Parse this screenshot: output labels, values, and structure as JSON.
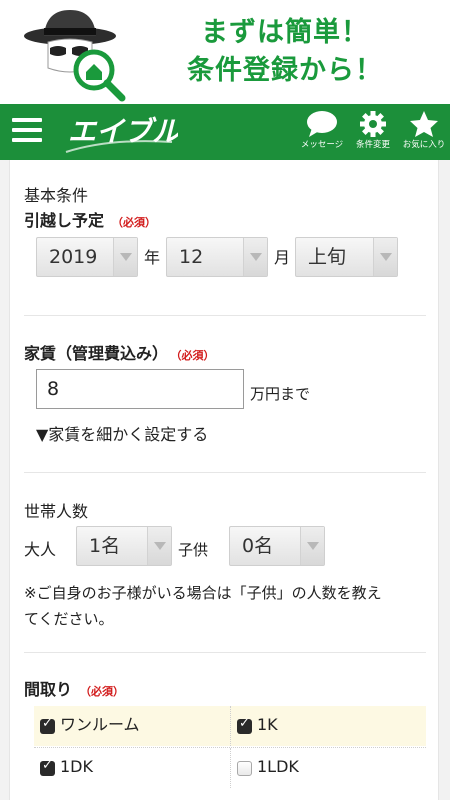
{
  "banner": {
    "line1": "まずは簡単！",
    "line2": "条件登録から！",
    "mascot_icon": "detective-search-icon",
    "text_color": "#1a9a3c"
  },
  "header": {
    "bg_color": "#1c8f3a",
    "logo_text": "エイブル",
    "menu_icon": "hamburger-menu-icon",
    "buttons": [
      {
        "icon": "speech-bubble-icon",
        "label": "メッセージ"
      },
      {
        "icon": "gear-icon",
        "label": "条件変更"
      },
      {
        "icon": "star-icon",
        "label": "お気に入り"
      }
    ]
  },
  "basic": {
    "section_label": "基本条件",
    "move_label": "引越し予定",
    "required": "（必須）",
    "year_value": "2019",
    "year_unit": "年",
    "month_value": "12",
    "month_unit": "月",
    "period_value": "上旬"
  },
  "rent": {
    "label": "家賃（管理費込み）",
    "required": "（必須）",
    "value": "8",
    "unit": "万円まで",
    "detail_link": "▼家賃を細かく設定する"
  },
  "household": {
    "label": "世帯人数",
    "adult_label": "大人",
    "adult_value": "1名",
    "child_label": "子供",
    "child_value": "0名",
    "note_line1": "※ご自身のお子様がいる場合は「子供」の人数を教え",
    "note_line2": "てください。"
  },
  "layout": {
    "label": "間取り",
    "required": "（必須）",
    "options": [
      {
        "label": "ワンルーム",
        "checked": true
      },
      {
        "label": "1K",
        "checked": true
      },
      {
        "label": "1DK",
        "checked": true
      },
      {
        "label": "1LDK",
        "checked": false
      }
    ]
  }
}
